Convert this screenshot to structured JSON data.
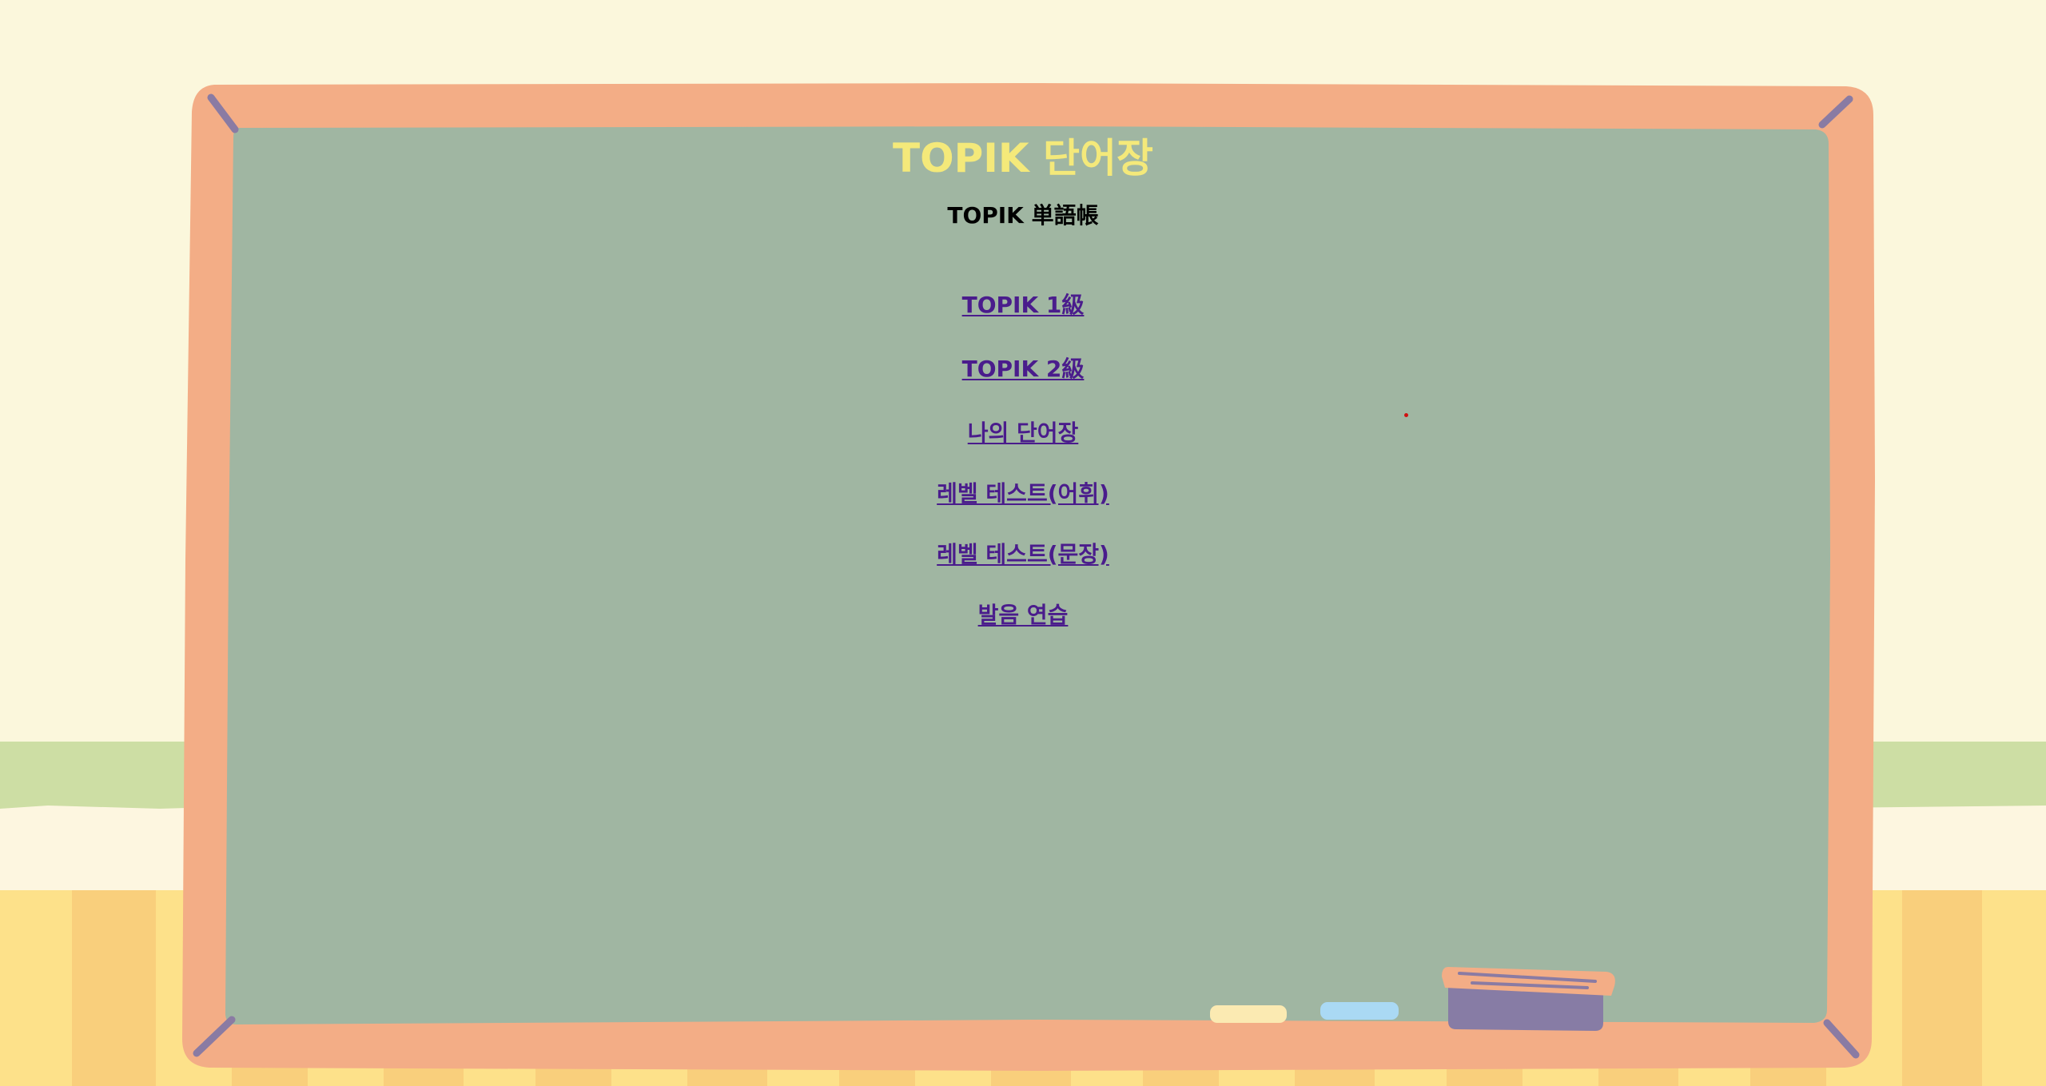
{
  "header": {
    "title": "TOPIK 단어장",
    "subtitle": "TOPIK 単語帳"
  },
  "menu": {
    "items": [
      {
        "label": "TOPIK 1級"
      },
      {
        "label": "TOPIK 2級"
      },
      {
        "label": "나의 단어장"
      },
      {
        "label": "레벨 테스트(어휘)"
      },
      {
        "label": "레벨 테스트(문장)"
      },
      {
        "label": "발음 연습"
      }
    ]
  },
  "colors": {
    "wall": "#fbf7dc",
    "stripe": "#cddea4",
    "floor": "#fde18a",
    "board_frame": "#f3ad86",
    "board_surface": "#a0b6a2",
    "title": "#f4e97a",
    "link": "#4a1c8c"
  }
}
